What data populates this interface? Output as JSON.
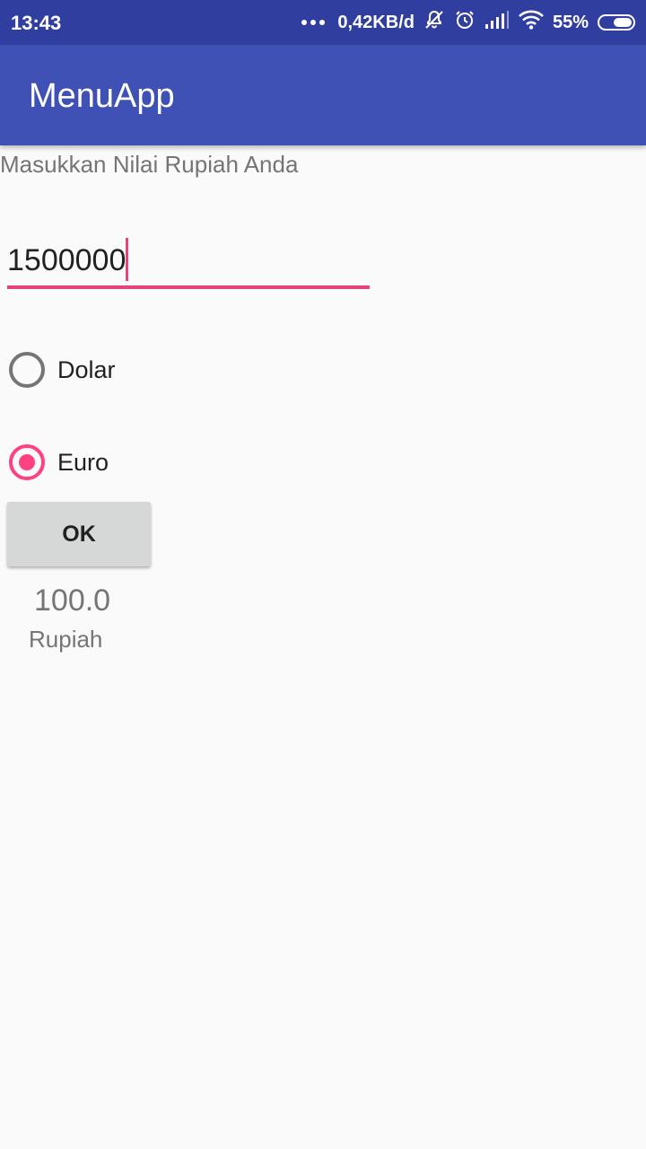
{
  "status_bar": {
    "time": "13:43",
    "network_speed": "0,42KB/d",
    "battery_percent": "55%",
    "icons": [
      "more-dots-icon",
      "silent-bell-icon",
      "alarm-icon",
      "signal-icon",
      "wifi-icon",
      "battery-icon"
    ]
  },
  "app_bar": {
    "title": "MenuApp",
    "color": "#3f51b5"
  },
  "form": {
    "prompt_label": "Masukkan Nilai Rupiah Anda",
    "amount_value": "1500000",
    "accent_color": "#ff4081",
    "options": [
      {
        "label": "Dolar",
        "checked": false
      },
      {
        "label": "Euro",
        "checked": true
      }
    ],
    "ok_label": "OK"
  },
  "result": {
    "value": "100.0",
    "unit": "Rupiah"
  }
}
